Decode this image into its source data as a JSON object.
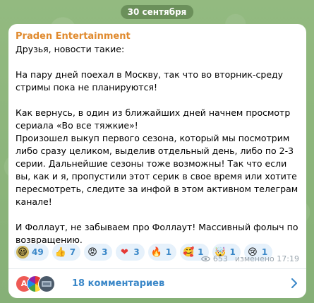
{
  "date_pill": "30 сентября",
  "post": {
    "sender": "Praden Entertainment",
    "paragraphs": [
      "Друзья, новости такие:",
      "На пару дней поехал в Москву, так что во вторник-среду стримы пока не планируются!",
      "Как вернусь, в один из ближайших дней начнем просмотр сериала «Во все тяжкие»!\nПроизошел выкуп первого сезона, который мы посмотрим либо сразу целиком, выделив отдельный день, либо по 2-3 серии. Дальнейшие сезоны тоже возможны! Так что если вы, как и я, пропустили этот серик в свое время или хотите пересмотреть, следите за инфой в этом активном телеграм канале!",
      "И Фоллаут, не забываем про Фоллаут! Массивный фолыч по возвращению."
    ],
    "reactions": [
      {
        "icon": "smiley-sticker-icon",
        "glyph": "😃",
        "count": "49"
      },
      {
        "icon": "thumbs-up-icon",
        "glyph": "👍",
        "count": "7"
      },
      {
        "icon": "angry-face-icon",
        "glyph": "😡",
        "count": "3"
      },
      {
        "icon": "heart-hands-icon",
        "glyph": "❤",
        "count": "3"
      },
      {
        "icon": "fire-icon",
        "glyph": "🔥",
        "count": "1"
      },
      {
        "icon": "hearts-face-icon",
        "glyph": "🥰",
        "count": "1"
      },
      {
        "icon": "exploding-head-icon",
        "glyph": "🤯",
        "count": "1"
      },
      {
        "icon": "crying-face-icon",
        "glyph": "😢",
        "count": "1"
      }
    ],
    "views": "653",
    "edited_time": "изменено 17:19",
    "comments_label": "18 комментариев",
    "commenter_avatar_initial": "A"
  },
  "colors": {
    "sender": "#e08a2e",
    "reaction_count": "#3a87c8",
    "reaction_bg": "#e6f1fb",
    "background": "#8fb77e"
  }
}
